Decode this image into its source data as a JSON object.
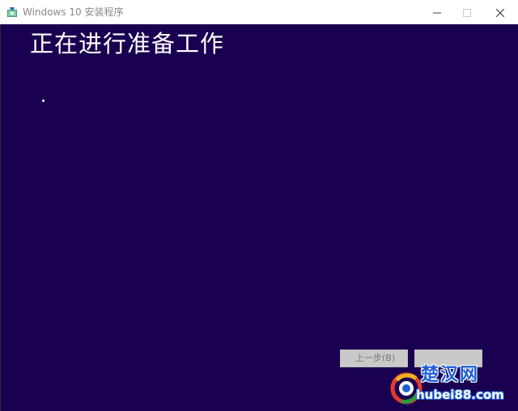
{
  "window": {
    "title": "Windows 10 安装程序",
    "icon": "setup-app-icon",
    "controls": {
      "minimize_icon": "minimize-icon",
      "maximize_icon": "maximize-icon",
      "close_icon": "close-icon",
      "maximize_disabled": true
    }
  },
  "main": {
    "heading": "正在进行准备工作",
    "progress_indicator": "spinner-dot",
    "background_color": "#1a0051"
  },
  "footer": {
    "back_label": "上一步(B)",
    "next_label": "",
    "buttons_disabled": true
  },
  "watermark": {
    "title": "楚汉网",
    "url": "hubei88.com"
  },
  "colors": {
    "content_background": "#1a0051",
    "titlebar": "#ffffff",
    "heading_text": "#ffffff",
    "watermark_blue": "#1f5fd6"
  }
}
